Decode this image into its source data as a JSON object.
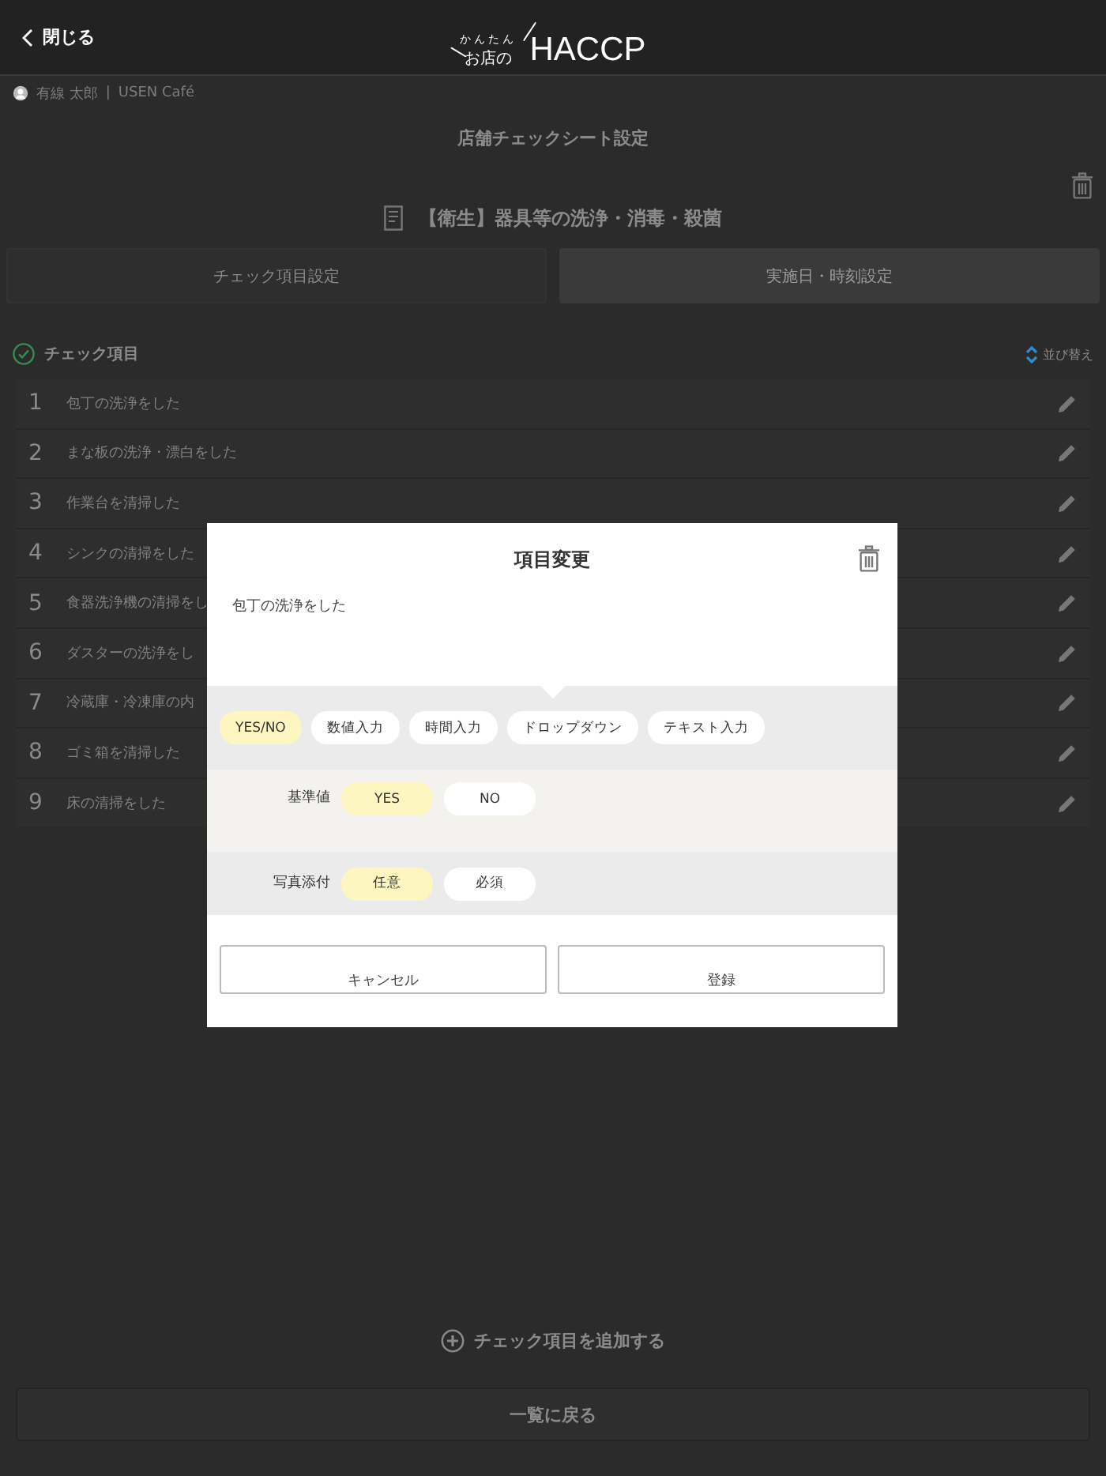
{
  "header": {
    "back_label": "閉じる",
    "logo_small": "かんたん",
    "logo_mid": "お店の",
    "logo_main": "HACCP"
  },
  "user_bar": {
    "user": "有線 太郎",
    "separator": "|",
    "store": "USEN Café"
  },
  "page_title": "店舗チェックシート設定",
  "sheet_title": "【衛生】器具等の洗浄・消毒・殺菌",
  "tabs": [
    {
      "label": "チェック項目設定",
      "selected": true
    },
    {
      "label": "実施日・時刻設定",
      "selected": false
    }
  ],
  "section": {
    "title": "チェック項目",
    "sort_label": "並び替え"
  },
  "items": [
    {
      "number": "1",
      "label": "包丁の洗浄をした"
    },
    {
      "number": "2",
      "label": "まな板の洗浄・漂白をした"
    },
    {
      "number": "3",
      "label": "作業台を清掃した"
    },
    {
      "number": "4",
      "label": "シンクの清掃をした"
    },
    {
      "number": "5",
      "label": "食器洗浄機の清掃をし"
    },
    {
      "number": "6",
      "label": "ダスターの洗浄をし"
    },
    {
      "number": "7",
      "label": "冷蔵庫・冷凍庫の内"
    },
    {
      "number": "8",
      "label": "ゴミ箱を清掃した"
    },
    {
      "number": "9",
      "label": "床の清掃をした"
    }
  ],
  "add_label": "チェック項目を追加する",
  "back_button": "一覧に戻る",
  "dialog": {
    "title": "項目変更",
    "item_text": "包丁の洗浄をした",
    "input_types": [
      {
        "label": "YES/NO",
        "selected": true
      },
      {
        "label": "数値入力",
        "selected": false
      },
      {
        "label": "時間入力",
        "selected": false
      },
      {
        "label": "ドロップダウン",
        "selected": false
      },
      {
        "label": "テキスト入力",
        "selected": false
      }
    ],
    "settings": [
      {
        "label": "基準値",
        "options": [
          {
            "label": "YES",
            "selected": true
          },
          {
            "label": "NO",
            "selected": false
          }
        ]
      },
      {
        "label": "写真添付",
        "options": [
          {
            "label": "任意",
            "selected": true
          },
          {
            "label": "必須",
            "selected": false
          }
        ]
      }
    ],
    "buttons": [
      {
        "label": "キャンセル"
      },
      {
        "label": "登録"
      }
    ]
  }
}
